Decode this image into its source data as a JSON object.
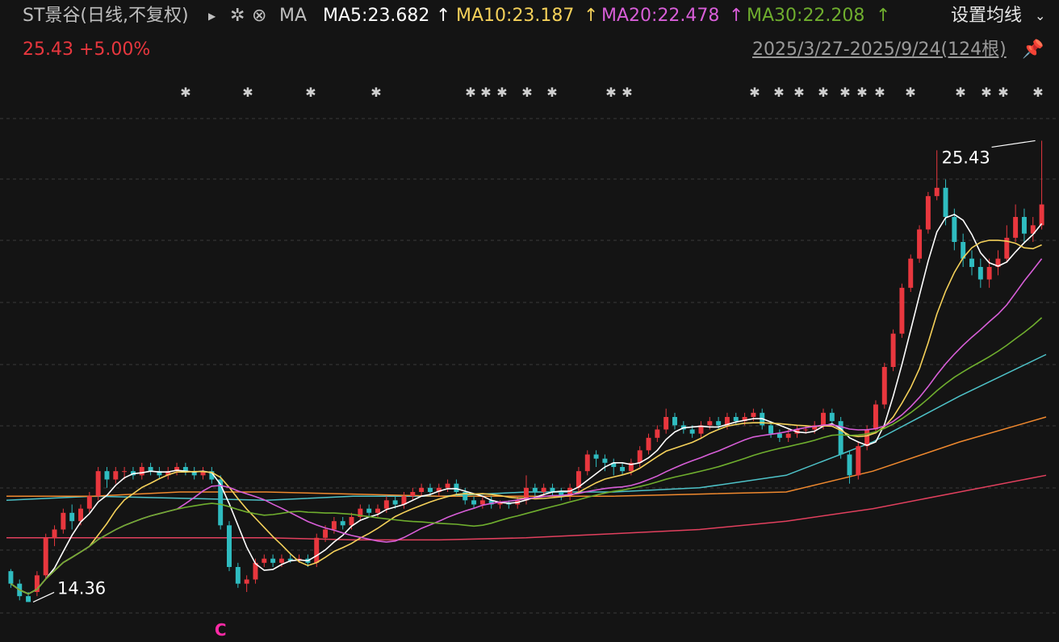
{
  "header": {
    "title": "ST景谷(日线,不复权)",
    "arrow_icon": "play-right-icon",
    "settings_icon": "gear-icon",
    "close_icon": "close-circle-icon",
    "ma_label": "MA",
    "ma5": "MA5:23.682",
    "ma10": "MA10:23.187",
    "ma20": "MA20:22.478",
    "ma30": "MA30:22.208",
    "ma_settings": "设置均线",
    "price": "25.43",
    "change": "+5.00%",
    "range": "2025/3/27-2025/9/24(124根)",
    "pin_icon": "pin-icon"
  },
  "colors": {
    "bg": "#141414",
    "up": "#e8373e",
    "down": "#2fbcc0",
    "ma5": "#ffffff",
    "ma10": "#f5d15a",
    "ma20": "#d85ed8",
    "ma30": "#6fae2e",
    "ma60": "#4ec3c9",
    "ma120": "#f0892e",
    "ma250": "#e2405e",
    "grey": "#bfbfbf"
  },
  "chart_data": {
    "type": "candlestick",
    "period": "daily",
    "date_range": "2025/3/27-2025/9/24",
    "bar_count": 124,
    "y_range": [
      14.0,
      26.0
    ],
    "grid": true,
    "annotations": {
      "max_label": "25.43",
      "min_label": "14.36",
      "marker_label": "C"
    },
    "ma_current": {
      "MA5": 23.682,
      "MA10": 23.187,
      "MA20": 22.478,
      "MA30": 22.208
    },
    "candles": [
      [
        15.1,
        14.8,
        15.15,
        14.7
      ],
      [
        14.8,
        14.5,
        14.9,
        14.4
      ],
      [
        14.5,
        14.36,
        14.6,
        14.36
      ],
      [
        14.6,
        15.0,
        15.1,
        14.5
      ],
      [
        15.0,
        15.9,
        16.0,
        14.9
      ],
      [
        15.9,
        16.1,
        16.2,
        15.7
      ],
      [
        16.1,
        16.5,
        16.6,
        16.0
      ],
      [
        16.5,
        16.3,
        16.7,
        16.1
      ],
      [
        16.3,
        16.6,
        16.7,
        16.2
      ],
      [
        16.6,
        16.9,
        17.0,
        16.5
      ],
      [
        16.9,
        17.5,
        17.6,
        16.8
      ],
      [
        17.5,
        17.3,
        17.6,
        17.1
      ],
      [
        17.3,
        17.5,
        17.6,
        17.2
      ],
      [
        17.5,
        17.5,
        17.6,
        17.3
      ],
      [
        17.5,
        17.4,
        17.6,
        17.3
      ],
      [
        17.4,
        17.6,
        17.7,
        17.3
      ],
      [
        17.6,
        17.5,
        17.7,
        17.4
      ],
      [
        17.5,
        17.4,
        17.6,
        17.3
      ],
      [
        17.4,
        17.5,
        17.6,
        17.3
      ],
      [
        17.5,
        17.6,
        17.7,
        17.4
      ],
      [
        17.6,
        17.5,
        17.7,
        17.4
      ],
      [
        17.5,
        17.4,
        17.6,
        17.3
      ],
      [
        17.4,
        17.5,
        17.6,
        17.3
      ],
      [
        17.5,
        17.3,
        17.6,
        17.2
      ],
      [
        17.3,
        16.2,
        17.4,
        16.1
      ],
      [
        16.2,
        15.2,
        16.3,
        15.1
      ],
      [
        15.2,
        14.8,
        15.3,
        14.7
      ],
      [
        14.8,
        14.9,
        15.0,
        14.6
      ],
      [
        14.9,
        15.3,
        15.4,
        14.8
      ],
      [
        15.3,
        15.4,
        15.5,
        15.2
      ],
      [
        15.4,
        15.3,
        15.5,
        15.2
      ],
      [
        15.3,
        15.4,
        15.5,
        15.2
      ],
      [
        15.4,
        15.35,
        15.5,
        15.3
      ],
      [
        15.35,
        15.4,
        15.5,
        15.3
      ],
      [
        15.4,
        15.3,
        15.5,
        15.2
      ],
      [
        15.3,
        15.9,
        16.0,
        15.2
      ],
      [
        15.9,
        16.1,
        16.2,
        15.8
      ],
      [
        16.1,
        16.3,
        16.4,
        16.0
      ],
      [
        16.3,
        16.2,
        16.4,
        16.1
      ],
      [
        16.2,
        16.4,
        16.5,
        16.1
      ],
      [
        16.4,
        16.6,
        16.7,
        16.3
      ],
      [
        16.6,
        16.5,
        16.7,
        16.4
      ],
      [
        16.5,
        16.6,
        16.7,
        16.4
      ],
      [
        16.6,
        16.8,
        16.9,
        16.5
      ],
      [
        16.8,
        16.7,
        16.9,
        16.6
      ],
      [
        16.7,
        16.9,
        17.0,
        16.6
      ],
      [
        16.9,
        17.0,
        17.1,
        16.8
      ],
      [
        17.0,
        17.1,
        17.2,
        16.9
      ],
      [
        17.1,
        17.0,
        17.2,
        16.9
      ],
      [
        17.0,
        17.1,
        17.2,
        16.9
      ],
      [
        17.1,
        17.2,
        17.3,
        17.0
      ],
      [
        17.2,
        17.0,
        17.3,
        16.9
      ],
      [
        17.0,
        16.8,
        17.1,
        16.7
      ],
      [
        16.8,
        16.7,
        16.9,
        16.6
      ],
      [
        16.7,
        16.8,
        16.9,
        16.6
      ],
      [
        16.8,
        16.7,
        16.9,
        16.6
      ],
      [
        16.7,
        16.75,
        16.8,
        16.6
      ],
      [
        16.75,
        16.7,
        16.8,
        16.6
      ],
      [
        16.7,
        16.8,
        16.9,
        16.6
      ],
      [
        16.8,
        17.1,
        17.4,
        16.7
      ],
      [
        17.1,
        17.0,
        17.2,
        16.9
      ],
      [
        17.0,
        17.1,
        17.2,
        16.9
      ],
      [
        17.1,
        17.0,
        17.2,
        16.9
      ],
      [
        17.0,
        16.9,
        17.1,
        16.8
      ],
      [
        16.9,
        17.1,
        17.2,
        16.8
      ],
      [
        17.1,
        17.5,
        17.6,
        17.0
      ],
      [
        17.5,
        17.9,
        18.0,
        17.4
      ],
      [
        17.9,
        17.8,
        18.0,
        17.6
      ],
      [
        17.8,
        17.7,
        17.9,
        17.5
      ],
      [
        17.7,
        17.6,
        17.8,
        17.4
      ],
      [
        17.6,
        17.5,
        17.7,
        17.4
      ],
      [
        17.5,
        17.7,
        17.8,
        17.4
      ],
      [
        17.7,
        18.0,
        18.1,
        17.6
      ],
      [
        18.0,
        18.3,
        18.4,
        17.9
      ],
      [
        18.3,
        18.5,
        18.6,
        18.2
      ],
      [
        18.5,
        18.8,
        19.0,
        18.4
      ],
      [
        18.8,
        18.6,
        18.9,
        18.5
      ],
      [
        18.6,
        18.5,
        18.7,
        18.4
      ],
      [
        18.5,
        18.4,
        18.6,
        18.3
      ],
      [
        18.4,
        18.6,
        18.7,
        18.3
      ],
      [
        18.6,
        18.7,
        18.8,
        18.5
      ],
      [
        18.7,
        18.6,
        18.8,
        18.5
      ],
      [
        18.6,
        18.8,
        18.9,
        18.5
      ],
      [
        18.8,
        18.7,
        18.9,
        18.6
      ],
      [
        18.7,
        18.8,
        18.9,
        18.6
      ],
      [
        18.8,
        18.9,
        19.0,
        18.7
      ],
      [
        18.9,
        18.6,
        19.0,
        18.5
      ],
      [
        18.6,
        18.4,
        18.7,
        18.3
      ],
      [
        18.4,
        18.3,
        18.5,
        18.2
      ],
      [
        18.3,
        18.4,
        18.5,
        18.2
      ],
      [
        18.4,
        18.5,
        18.6,
        18.3
      ],
      [
        18.5,
        18.5,
        18.6,
        18.4
      ],
      [
        18.5,
        18.6,
        18.7,
        18.4
      ],
      [
        18.6,
        18.9,
        19.0,
        18.5
      ],
      [
        18.9,
        18.7,
        19.0,
        18.6
      ],
      [
        18.7,
        17.9,
        18.8,
        17.8
      ],
      [
        17.9,
        17.4,
        18.0,
        17.2
      ],
      [
        17.4,
        18.1,
        18.2,
        17.3
      ],
      [
        18.1,
        18.5,
        18.6,
        18.0
      ],
      [
        18.5,
        19.1,
        19.2,
        18.4
      ],
      [
        19.1,
        20.0,
        20.1,
        19.0
      ],
      [
        20.0,
        20.8,
        20.9,
        19.9
      ],
      [
        20.8,
        21.9,
        22.0,
        20.7
      ],
      [
        21.9,
        22.6,
        22.7,
        21.8
      ],
      [
        22.6,
        23.3,
        23.4,
        22.5
      ],
      [
        23.3,
        24.1,
        24.2,
        23.2
      ],
      [
        24.1,
        24.3,
        25.2,
        24.0
      ],
      [
        24.3,
        23.6,
        24.5,
        23.4
      ],
      [
        23.6,
        23.0,
        23.8,
        22.8
      ],
      [
        23.0,
        22.6,
        23.2,
        22.4
      ],
      [
        22.6,
        22.4,
        22.8,
        22.2
      ],
      [
        22.4,
        22.1,
        22.6,
        21.9
      ],
      [
        22.1,
        22.4,
        22.6,
        21.9
      ],
      [
        22.4,
        22.6,
        22.8,
        22.2
      ],
      [
        22.6,
        23.1,
        23.4,
        22.5
      ],
      [
        23.1,
        23.6,
        23.9,
        23.0
      ],
      [
        23.6,
        23.2,
        23.8,
        23.0
      ],
      [
        23.2,
        23.4,
        23.6,
        23.0
      ],
      [
        23.4,
        23.9,
        25.43,
        23.3
      ]
    ]
  }
}
